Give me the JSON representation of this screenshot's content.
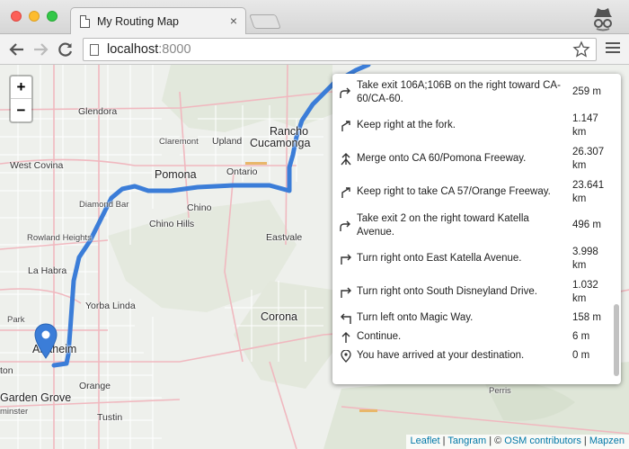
{
  "browser": {
    "tab_title": "My Routing Map",
    "tab_close": "×",
    "url_host": "localhost",
    "url_port": ":8000"
  },
  "map": {
    "zoom_in": "+",
    "zoom_out": "−",
    "route_color": "#3b7dd8",
    "marker_color": "#3b7dd8",
    "towns": [
      {
        "name": "Glendora"
      },
      {
        "name": "Rancho"
      },
      {
        "name": "Cucamonga"
      },
      {
        "name": "Claremont"
      },
      {
        "name": "Upland"
      },
      {
        "name": "West Covina"
      },
      {
        "name": "Pomona"
      },
      {
        "name": "Ontario"
      },
      {
        "name": "Diamond Bar"
      },
      {
        "name": "Chino"
      },
      {
        "name": "Chino Hills"
      },
      {
        "name": "Rowland Heights"
      },
      {
        "name": "Eastvale"
      },
      {
        "name": "La Habra"
      },
      {
        "name": "Yorba Linda"
      },
      {
        "name": "Corona"
      },
      {
        "name": "Anaheim"
      },
      {
        "name": "Garden Grove"
      },
      {
        "name": "Orange"
      },
      {
        "name": "Tustin"
      },
      {
        "name": "Perris"
      },
      {
        "name": "Park"
      },
      {
        "name": "ton"
      },
      {
        "name": "minster"
      }
    ]
  },
  "instructions": [
    {
      "icon": "bear-right-icon",
      "text": "Take exit 106A;106B on the right toward CA-60/CA-60.",
      "distance": "259 m"
    },
    {
      "icon": "slight-right-icon",
      "text": "Keep right at the fork.",
      "distance": "1.147 km"
    },
    {
      "icon": "merge-icon",
      "text": "Merge onto CA 60/Pomona Freeway.",
      "distance": "26.307 km"
    },
    {
      "icon": "slight-right-icon",
      "text": "Keep right to take CA 57/Orange Freeway.",
      "distance": "23.641 km"
    },
    {
      "icon": "bear-right-icon",
      "text": "Take exit 2 on the right toward Katella Avenue.",
      "distance": "496 m"
    },
    {
      "icon": "turn-right-icon",
      "text": "Turn right onto East Katella Avenue.",
      "distance": "3.998 km"
    },
    {
      "icon": "turn-right-icon",
      "text": "Turn right onto South Disneyland Drive.",
      "distance": "1.032 km"
    },
    {
      "icon": "turn-left-icon",
      "text": "Turn left onto Magic Way.",
      "distance": "158 m"
    },
    {
      "icon": "continue-icon",
      "text": "Continue.",
      "distance": "6 m"
    },
    {
      "icon": "destination-pin-icon",
      "text": "You have arrived at your destination.",
      "distance": "0 m"
    }
  ],
  "attribution": {
    "leaflet": "Leaflet",
    "sep1": " | ",
    "tangram": "Tangram",
    "sep2": " | © ",
    "osm": "OSM contributors",
    "sep3": " | ",
    "mapzen": "Mapzen"
  }
}
